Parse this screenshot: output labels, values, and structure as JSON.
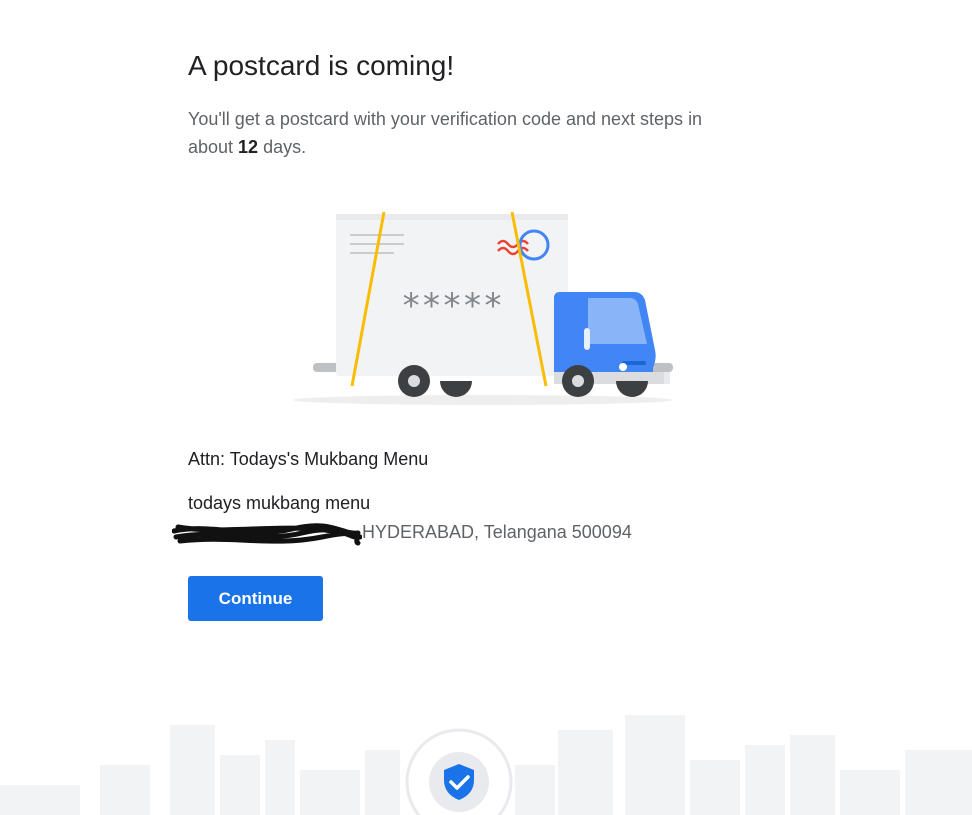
{
  "heading": "A postcard is coming!",
  "description": {
    "before": "You'll get a postcard with your verification code and next steps in about ",
    "days": "12",
    "after": " days."
  },
  "illustration": {
    "code_placeholder": "*****",
    "truck_color": "#4285f4",
    "postcard_color": "#f1f3f4",
    "strap_color": "#fbbc04",
    "stamp_colors": [
      "#ea4335",
      "#4285f4"
    ]
  },
  "attn": "Attn: Todays's Mukbang Menu",
  "business_name": "todays mukbang menu",
  "address": "HYDERABAD, Telangana 500094",
  "continue_label": "Continue",
  "colors": {
    "accent": "#1a73e8",
    "text_primary": "#202124",
    "text_secondary": "#5f6368",
    "skyline": "#f1f3f4"
  },
  "icons": {
    "verified_badge": "shield-check-icon"
  }
}
